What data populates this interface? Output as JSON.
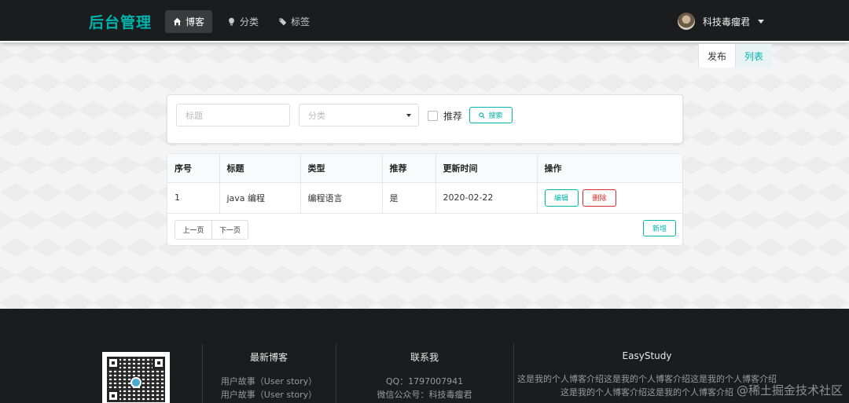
{
  "nav": {
    "brand": "后台管理",
    "items": [
      {
        "label": "博客",
        "icon": "home-icon"
      },
      {
        "label": "分类",
        "icon": "lightbulb-icon"
      },
      {
        "label": "标签",
        "icon": "tags-icon"
      }
    ],
    "user_name": "科技毒瘤君"
  },
  "submenu": {
    "publish": "发布",
    "list": "列表"
  },
  "search": {
    "title_placeholder": "标题",
    "category_placeholder": "分类",
    "recommend_label": "推荐",
    "search_label": "搜索"
  },
  "table": {
    "headers": [
      "序号",
      "标题",
      "类型",
      "推荐",
      "更新时间",
      "操作"
    ],
    "rows": [
      {
        "id": "1",
        "title": "java 编程",
        "type": "编程语言",
        "recommend": "是",
        "updated": "2020-02-22",
        "edit": "编辑",
        "delete": "删除"
      }
    ],
    "prev": "上一页",
    "next": "下一页",
    "add": "新增"
  },
  "footer": {
    "latest_title": "最新博客",
    "latest_items": [
      "用户故事（User story）",
      "用户故事（User story）"
    ],
    "contact_title": "联系我",
    "contact_qq": "QQ：1797007941",
    "contact_wechat": "微信公众号：科技毒瘤君",
    "about_title": "EasyStudy",
    "about_text": "这是我的个人博客介绍这是我的个人博客介绍这是我的个人博客介绍这是我的个人博客介绍这是我的个人博客介绍",
    "watermark": "@稀土掘金技术社区"
  },
  "colors": {
    "accent": "#00b5ad",
    "danger": "#db2828",
    "dark": "#1b1c1d"
  }
}
